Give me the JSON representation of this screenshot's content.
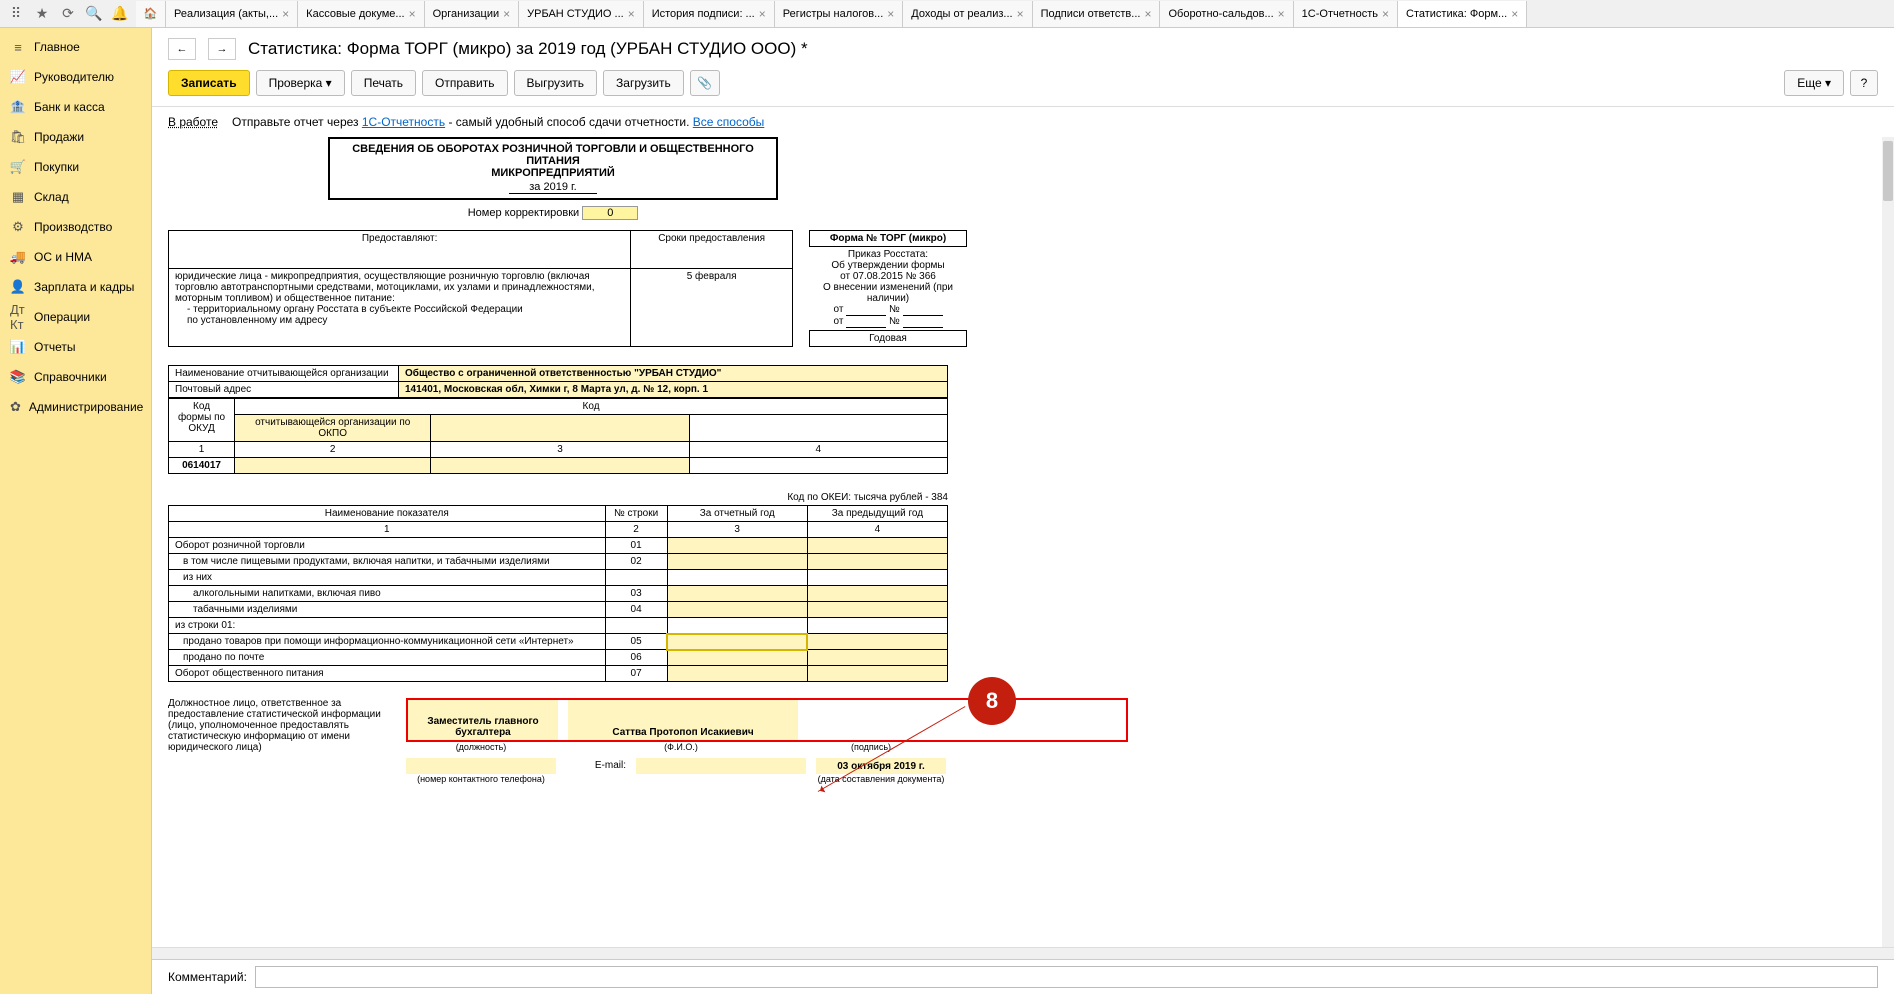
{
  "tabs": [
    {
      "label": "Реализация (акты,..."
    },
    {
      "label": "Кассовые докуме..."
    },
    {
      "label": "Организации"
    },
    {
      "label": "УРБАН СТУДИО ..."
    },
    {
      "label": "История подписи: ..."
    },
    {
      "label": "Регистры налогов..."
    },
    {
      "label": "Доходы от реализ..."
    },
    {
      "label": "Подписи ответств..."
    },
    {
      "label": "Оборотно-сальдов..."
    },
    {
      "label": "1С-Отчетность"
    },
    {
      "label": "Статистика: Форм...",
      "active": true
    }
  ],
  "sidebar": [
    {
      "icon": "≡",
      "label": "Главное"
    },
    {
      "icon": "📈",
      "label": "Руководителю"
    },
    {
      "icon": "🏦",
      "label": "Банк и касса"
    },
    {
      "icon": "🛍",
      "label": "Продажи"
    },
    {
      "icon": "🛒",
      "label": "Покупки"
    },
    {
      "icon": "▦",
      "label": "Склад"
    },
    {
      "icon": "⚙",
      "label": "Производство"
    },
    {
      "icon": "🚚",
      "label": "ОС и НМА"
    },
    {
      "icon": "👤",
      "label": "Зарплата и кадры"
    },
    {
      "icon": "Дт Кт",
      "label": "Операции"
    },
    {
      "icon": "📊",
      "label": "Отчеты"
    },
    {
      "icon": "📚",
      "label": "Справочники"
    },
    {
      "icon": "✿",
      "label": "Администрирование"
    }
  ],
  "header": {
    "title": "Статистика: Форма ТОРГ (микро) за 2019 год (УРБАН СТУДИО ООО) *"
  },
  "toolbar": {
    "save": "Записать",
    "check": "Проверка ▾",
    "print": "Печать",
    "send": "Отправить",
    "export": "Выгрузить",
    "import": "Загрузить",
    "more": "Еще ▾",
    "help": "?"
  },
  "infobar": {
    "status": "В работе",
    "text1": "Отправьте отчет через ",
    "link1": "1С-Отчетность",
    "text2": " - самый удобный способ сдачи отчетности. ",
    "link2": "Все способы"
  },
  "doc": {
    "title1": "СВЕДЕНИЯ ОБ ОБОРОТАХ РОЗНИЧНОЙ ТОРГОВЛИ И ОБЩЕСТВЕННОГО ПИТАНИЯ",
    "title2": "МИКРОПРЕДПРИЯТИЙ",
    "period": "за 2019 г.",
    "corr_label": "Номер корректировки",
    "corr_value": "0",
    "prov": {
      "h1": "Предоставляют:",
      "h2": "Сроки предоставления",
      "text1": "юридические лица - микропредприятия, осуществляющие розничную торговлю (включая торговлю автотранспортными средствами, мотоциклами, их узлами и принадлежностями, моторным топливом) и общественное питание:",
      "text2": "- территориальному органу Росстата в субъекте Российской Федерации",
      "text3": "по установленному им адресу",
      "date": "5 февраля"
    },
    "form": {
      "name": "Форма № ТОРГ (микро)",
      "line1": "Приказ Росстата:",
      "line2": "Об утверждении формы",
      "line3": "от 07.08.2015 № 366",
      "line4": "О внесении изменений (при наличии)",
      "line5a": "от",
      "line5b": "№",
      "line6a": "от",
      "line6b": "№",
      "annual": "Годовая"
    },
    "org": {
      "name_label": "Наименование отчитывающейся организации",
      "name": "Общество с ограниченной ответственностью \"УРБАН СТУДИО\"",
      "addr_label": "Почтовый адрес",
      "addr": "141401, Московская обл, Химки г, 8 Марта ул, д. № 12, корп. 1"
    },
    "codes": {
      "h_code": "Код",
      "h_okud": "Код формы по ОКУД",
      "h_okpo": "отчитывающейся организации по ОКПО",
      "n1": "1",
      "n2": "2",
      "n3": "3",
      "n4": "4",
      "okud": "0614017"
    },
    "okei": "Код по ОКЕИ: тысяча рублей - 384",
    "data": {
      "h_name": "Наименование показателя",
      "h_row": "№ строки",
      "h_cur": "За отчетный год",
      "h_prev": "За предыдущий год",
      "rows": [
        {
          "n": "1",
          "name": "Оборот розничной торговли",
          "row": "01"
        },
        {
          "n": "2",
          "name": "в том числе пищевыми продуктами, включая напитки, и табачными изделиями",
          "row": "02",
          "ind": 1
        },
        {
          "n": "",
          "name": "из них",
          "row": "",
          "ind": 1,
          "nocode": true
        },
        {
          "n": "3",
          "name": "алкогольными напитками, включая пиво",
          "row": "03",
          "ind": 2
        },
        {
          "n": "4",
          "name": "табачными изделиями",
          "row": "04",
          "ind": 2
        },
        {
          "n": "",
          "name": "из строки 01:",
          "row": "",
          "ind": 0,
          "nocode": true
        },
        {
          "n": "5",
          "name": "продано товаров при помощи информационно-коммуникационной сети «Интернет»",
          "row": "05",
          "ind": 1,
          "sel": true
        },
        {
          "n": "6",
          "name": "продано по почте",
          "row": "06",
          "ind": 1
        },
        {
          "n": "7",
          "name": "Оборот общественного питания",
          "row": "07"
        }
      ]
    },
    "sign": {
      "left": "Должностное лицо, ответственное за предоставление статистической информации (лицо, уполномоченное предоставлять статистическую информацию от имени юридического лица)",
      "pos": "Заместитель главного бухгалтера",
      "pos_u": "(должность)",
      "fio": "Саттва Протопоп Исакиевич",
      "fio_u": "(Ф.И.О.)",
      "sig_u": "(подпись)",
      "email_l": "E-mail:",
      "phone_u": "(номер контактного телефона)",
      "date": "03 октября 2019 г.",
      "date_u": "(дата составления документа)"
    }
  },
  "callout": "8",
  "comment_label": "Комментарий:"
}
